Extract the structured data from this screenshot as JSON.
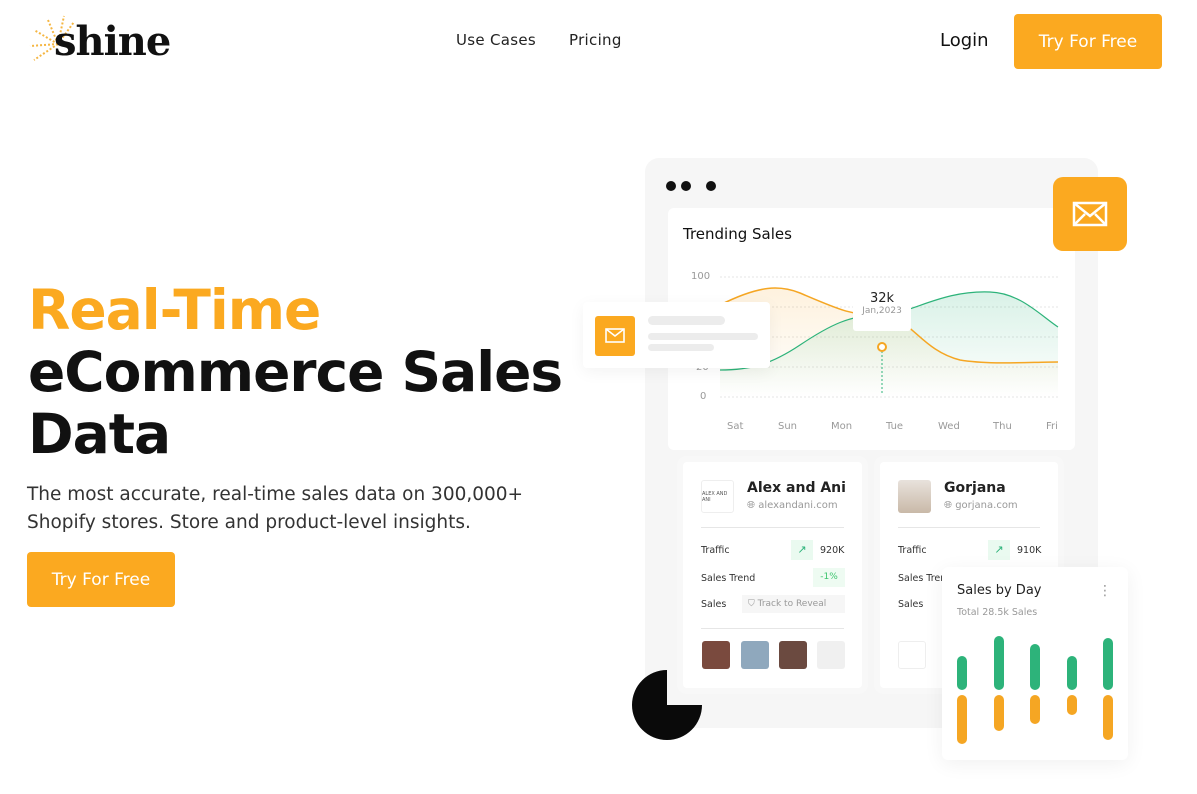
{
  "nav": {
    "logo": "shine",
    "links": [
      "Use Cases",
      "Pricing"
    ],
    "login": "Login",
    "cta": "Try For Free"
  },
  "hero": {
    "title_accent": "Real-Time",
    "title_line2": "eCommerce Sales",
    "title_line3": "Data",
    "subtitle_line1": "The most accurate, real-time sales data on 300,000+",
    "subtitle_line2": "Shopify stores. Store and product-level insights.",
    "cta": "Try For Free"
  },
  "colors": {
    "accent": "#FBA920",
    "green": "#2DB37A",
    "orange": "#F5A623"
  },
  "dashboard": {
    "trending": {
      "title": "Trending Sales",
      "y_ticks": [
        "100",
        "20",
        "0"
      ],
      "x_ticks": [
        "Sat",
        "Sun",
        "Mon",
        "Tue",
        "Wed",
        "Thu",
        "Fri"
      ],
      "tooltip_value": "32k",
      "tooltip_date": "Jan,2023"
    },
    "stores": [
      {
        "name": "Alex and Ani",
        "site": "alexandani.com",
        "logo_text": "ALEX AND ANI",
        "traffic_label": "Traffic",
        "traffic": "920K",
        "trend_label": "Sales Trend",
        "trend": "-1%",
        "sales_label": "Sales",
        "sales_cta": "Track to Reveal"
      },
      {
        "name": "Gorjana",
        "site": "gorjana.com",
        "traffic_label": "Traffic",
        "traffic": "910K",
        "trend_label": "Sales Trend",
        "sales_label": "Sales"
      }
    ],
    "sales_by_day": {
      "title": "Sales by Day",
      "subtitle": "Total 28.5k Sales",
      "icons": [
        "more-vertical-icon"
      ]
    }
  }
}
